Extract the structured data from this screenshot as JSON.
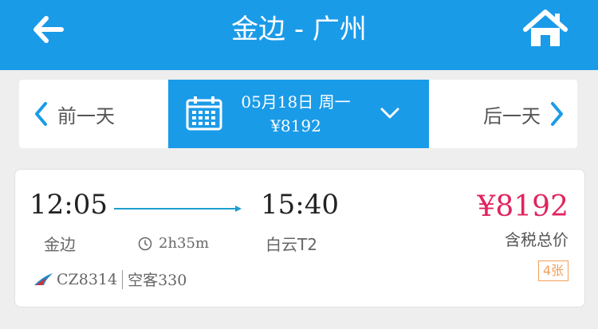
{
  "header": {
    "title": "金边 - 广州"
  },
  "datebar": {
    "prev_label": "前一天",
    "next_label": "后一天",
    "current_date": "05月18日 周一",
    "current_price": "¥8192"
  },
  "flight": {
    "departure_time": "12:05",
    "arrival_time": "15:40",
    "departure_city": "金边",
    "arrival_airport": "白云T2",
    "duration": "2h35m",
    "price": "¥8192",
    "price_label": "含税总价",
    "tickets_left": "4张",
    "flight_number": "CZ8314",
    "aircraft": "空客330"
  },
  "colors": {
    "primary": "#1a9be8",
    "price": "#e0245e",
    "tickets_badge": "#f29f5a"
  },
  "icons": {
    "back": "back-arrow-icon",
    "home": "home-icon",
    "calendar": "calendar-icon",
    "dropdown": "chevron-down-icon",
    "clock": "clock-icon",
    "airline": "china-southern-logo-icon"
  }
}
